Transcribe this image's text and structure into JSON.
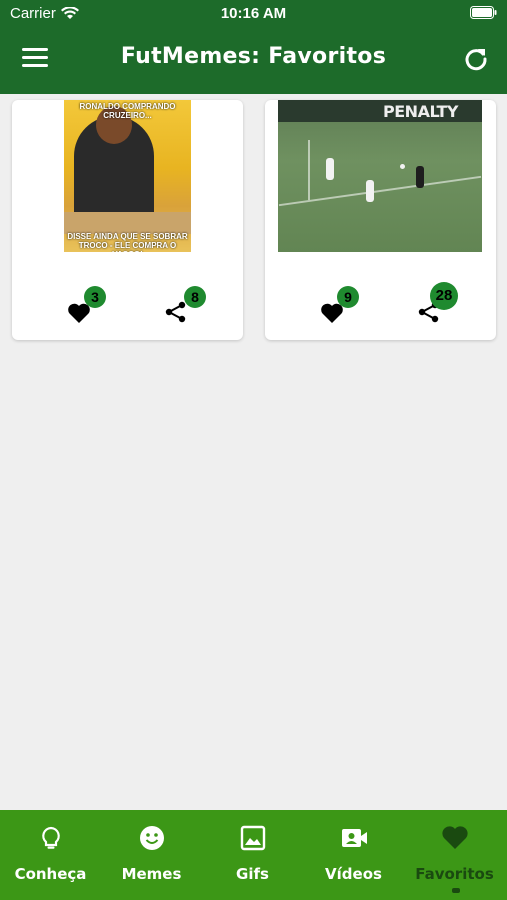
{
  "status_bar": {
    "carrier": "Carrier",
    "time": "10:16 AM"
  },
  "app_bar": {
    "title": "FutMemes: Favoritos"
  },
  "cards": [
    {
      "type": "image",
      "caption_top": "RONALDO COMPRANDO CRUZEIRO...",
      "caption_bottom": "DISSE AINDA QUE SE SOBRAR TROCO - ELE COMPRA O VASCO!",
      "likes": "3",
      "shares": "8"
    },
    {
      "type": "video",
      "banner": "PENALTY",
      "likes": "9",
      "shares": "28"
    }
  ],
  "tabs": [
    {
      "label": "Conheça",
      "icon": "lightbulb-icon"
    },
    {
      "label": "Memes",
      "icon": "smiley-icon"
    },
    {
      "label": "Gifs",
      "icon": "image-icon"
    },
    {
      "label": "Vídeos",
      "icon": "video-camera-icon"
    },
    {
      "label": "Favoritos",
      "icon": "heart-icon",
      "active": true
    }
  ],
  "colors": {
    "header": "#1d6b2a",
    "tabbar": "#3c9716",
    "badge": "#1f8a2f",
    "active_tab": "#1a4a10",
    "background": "#efefef"
  }
}
